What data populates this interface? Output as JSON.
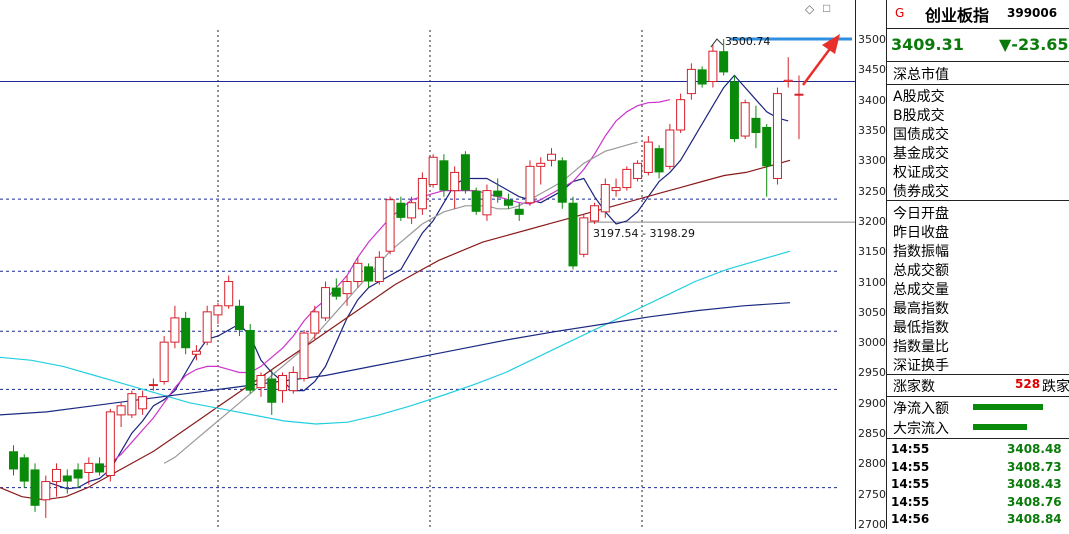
{
  "window": {
    "diamond_icon": "◇",
    "close_icon": "□"
  },
  "header": {
    "flag": "G",
    "name": "创业板指",
    "code": "399006"
  },
  "quote": {
    "price": "3409.31",
    "change": "▼-23.65"
  },
  "labels": {
    "market_value": "深总市值",
    "group1": [
      "A股成交",
      "B股成交",
      "国债成交",
      "基金成交",
      "权证成交",
      "债券成交"
    ],
    "group2": [
      "今日开盘",
      "昨日收盘",
      "指数振幅",
      "总成交额",
      "总成交量",
      "最高指数",
      "最低指数",
      "指数量比",
      "深证换手"
    ],
    "rise_label": "涨家数",
    "rise_value": "528",
    "fall_label": "跌家",
    "net_flow": "净流入额",
    "block_flow": "大宗流入"
  },
  "ticks": [
    {
      "time": "14:55",
      "price": "3408.48"
    },
    {
      "time": "14:55",
      "price": "3408.73"
    },
    {
      "time": "14:55",
      "price": "3408.43"
    },
    {
      "time": "14:55",
      "price": "3408.76"
    },
    {
      "time": "14:56",
      "price": "3408.84"
    }
  ],
  "colors": {
    "up": "#d6202a",
    "down": "#0a8a0a",
    "ma5": "#1a237e",
    "ma10": "#cc33cc",
    "ma20": "#999999",
    "ma60": "#8b1a1a",
    "ma120": "#22cfe0",
    "ma250": "#1a2a80",
    "arrow": "#e8302a",
    "target_line": "#2f8fe0"
  },
  "chart_data": {
    "type": "candlestick",
    "ylim": [
      2700,
      3510
    ],
    "yticks": [
      2700,
      2750,
      2800,
      2850,
      2900,
      2950,
      3000,
      3050,
      3100,
      3150,
      3200,
      3250,
      3300,
      3350,
      3400,
      3450,
      3500
    ],
    "annotations": {
      "high_label": "3500.74",
      "range_label": "3197.54 - 3198.29"
    },
    "dashed_levels": [
      3236,
      3117,
      3018,
      2922,
      2760
    ],
    "solid_levels": [
      3430,
      3198
    ],
    "target_level": 3500,
    "candles": [
      {
        "o": 2820,
        "h": 2830,
        "l": 2780,
        "c": 2790
      },
      {
        "o": 2810,
        "h": 2815,
        "l": 2760,
        "c": 2770
      },
      {
        "o": 2790,
        "h": 2800,
        "l": 2720,
        "c": 2730
      },
      {
        "o": 2740,
        "h": 2780,
        "l": 2710,
        "c": 2770
      },
      {
        "o": 2770,
        "h": 2800,
        "l": 2745,
        "c": 2790
      },
      {
        "o": 2780,
        "h": 2790,
        "l": 2750,
        "c": 2770
      },
      {
        "o": 2790,
        "h": 2800,
        "l": 2760,
        "c": 2775
      },
      {
        "o": 2785,
        "h": 2810,
        "l": 2765,
        "c": 2800
      },
      {
        "o": 2800,
        "h": 2810,
        "l": 2780,
        "c": 2785
      },
      {
        "o": 2780,
        "h": 2890,
        "l": 2770,
        "c": 2885
      },
      {
        "o": 2880,
        "h": 2900,
        "l": 2860,
        "c": 2895
      },
      {
        "o": 2880,
        "h": 2920,
        "l": 2875,
        "c": 2915
      },
      {
        "o": 2890,
        "h": 2920,
        "l": 2880,
        "c": 2910
      },
      {
        "o": 2930,
        "h": 2940,
        "l": 2920,
        "c": 2930
      },
      {
        "o": 2935,
        "h": 3010,
        "l": 2930,
        "c": 3000
      },
      {
        "o": 3000,
        "h": 3060,
        "l": 2990,
        "c": 3040
      },
      {
        "o": 3040,
        "h": 3050,
        "l": 2980,
        "c": 2990
      },
      {
        "o": 2980,
        "h": 2995,
        "l": 2970,
        "c": 2985
      },
      {
        "o": 3000,
        "h": 3060,
        "l": 2995,
        "c": 3050
      },
      {
        "o": 3045,
        "h": 3065,
        "l": 3030,
        "c": 3060
      },
      {
        "o": 3060,
        "h": 3110,
        "l": 3055,
        "c": 3100
      },
      {
        "o": 3060,
        "h": 3070,
        "l": 3010,
        "c": 3020
      },
      {
        "o": 3020,
        "h": 3030,
        "l": 2915,
        "c": 2920
      },
      {
        "o": 2925,
        "h": 2950,
        "l": 2910,
        "c": 2945
      },
      {
        "o": 2940,
        "h": 2955,
        "l": 2880,
        "c": 2900
      },
      {
        "o": 2920,
        "h": 2950,
        "l": 2900,
        "c": 2945
      },
      {
        "o": 2920,
        "h": 2960,
        "l": 2915,
        "c": 2950
      },
      {
        "o": 2940,
        "h": 3020,
        "l": 2935,
        "c": 3015
      },
      {
        "o": 3015,
        "h": 3060,
        "l": 3005,
        "c": 3050
      },
      {
        "o": 3040,
        "h": 3100,
        "l": 3035,
        "c": 3090
      },
      {
        "o": 3090,
        "h": 3105,
        "l": 3070,
        "c": 3075
      },
      {
        "o": 3080,
        "h": 3110,
        "l": 3060,
        "c": 3100
      },
      {
        "o": 3100,
        "h": 3140,
        "l": 3090,
        "c": 3130
      },
      {
        "o": 3125,
        "h": 3130,
        "l": 3090,
        "c": 3100
      },
      {
        "o": 3100,
        "h": 3150,
        "l": 3095,
        "c": 3140
      },
      {
        "o": 3150,
        "h": 3240,
        "l": 3145,
        "c": 3235
      },
      {
        "o": 3230,
        "h": 3240,
        "l": 3200,
        "c": 3205
      },
      {
        "o": 3205,
        "h": 3240,
        "l": 3195,
        "c": 3230
      },
      {
        "o": 3220,
        "h": 3280,
        "l": 3210,
        "c": 3270
      },
      {
        "o": 3260,
        "h": 3310,
        "l": 3255,
        "c": 3305
      },
      {
        "o": 3300,
        "h": 3310,
        "l": 3240,
        "c": 3250
      },
      {
        "o": 3250,
        "h": 3290,
        "l": 3220,
        "c": 3280
      },
      {
        "o": 3310,
        "h": 3315,
        "l": 3245,
        "c": 3250
      },
      {
        "o": 3250,
        "h": 3255,
        "l": 3210,
        "c": 3215
      },
      {
        "o": 3210,
        "h": 3260,
        "l": 3200,
        "c": 3250
      },
      {
        "o": 3250,
        "h": 3270,
        "l": 3230,
        "c": 3240
      },
      {
        "o": 3235,
        "h": 3245,
        "l": 3220,
        "c": 3225
      },
      {
        "o": 3220,
        "h": 3230,
        "l": 3200,
        "c": 3210
      },
      {
        "o": 3230,
        "h": 3300,
        "l": 3225,
        "c": 3290
      },
      {
        "o": 3290,
        "h": 3305,
        "l": 3260,
        "c": 3295
      },
      {
        "o": 3300,
        "h": 3320,
        "l": 3290,
        "c": 3310
      },
      {
        "o": 3300,
        "h": 3305,
        "l": 3220,
        "c": 3230
      },
      {
        "o": 3230,
        "h": 3240,
        "l": 3120,
        "c": 3125
      },
      {
        "o": 3145,
        "h": 3210,
        "l": 3140,
        "c": 3205
      },
      {
        "o": 3200,
        "h": 3230,
        "l": 3195,
        "c": 3225
      },
      {
        "o": 3215,
        "h": 3270,
        "l": 3205,
        "c": 3260
      },
      {
        "o": 3250,
        "h": 3270,
        "l": 3240,
        "c": 3255
      },
      {
        "o": 3255,
        "h": 3290,
        "l": 3250,
        "c": 3285
      },
      {
        "o": 3270,
        "h": 3300,
        "l": 3265,
        "c": 3295
      },
      {
        "o": 3280,
        "h": 3340,
        "l": 3275,
        "c": 3330
      },
      {
        "o": 3320,
        "h": 3325,
        "l": 3270,
        "c": 3280
      },
      {
        "o": 3290,
        "h": 3360,
        "l": 3285,
        "c": 3350
      },
      {
        "o": 3350,
        "h": 3410,
        "l": 3345,
        "c": 3400
      },
      {
        "o": 3410,
        "h": 3460,
        "l": 3400,
        "c": 3450
      },
      {
        "o": 3450,
        "h": 3455,
        "l": 3420,
        "c": 3425
      },
      {
        "o": 3430,
        "h": 3490,
        "l": 3420,
        "c": 3480
      },
      {
        "o": 3480,
        "h": 3500,
        "l": 3440,
        "c": 3445
      },
      {
        "o": 3430,
        "h": 3440,
        "l": 3330,
        "c": 3335
      },
      {
        "o": 3340,
        "h": 3400,
        "l": 3335,
        "c": 3395
      },
      {
        "o": 3370,
        "h": 3390,
        "l": 3320,
        "c": 3345
      },
      {
        "o": 3355,
        "h": 3360,
        "l": 3240,
        "c": 3290
      },
      {
        "o": 3270,
        "h": 3420,
        "l": 3260,
        "c": 3410
      },
      {
        "o": 3430,
        "h": 3470,
        "l": 3420,
        "c": 3432
      },
      {
        "o": 3408,
        "h": 3440,
        "l": 3335,
        "c": 3409
      }
    ],
    "ma_series": [
      {
        "key": "ma5",
        "offset": 3,
        "values": [
          2770,
          2764,
          2758,
          2760,
          2770,
          2775,
          2790,
          2820,
          2850,
          2870,
          2895,
          2905,
          2920,
          2950,
          2980,
          3005,
          3010,
          3020,
          3030,
          3010,
          2970,
          2950,
          2935,
          2920,
          2920,
          2935,
          2960,
          3000,
          3040,
          3070,
          3090,
          3100,
          3110,
          3120,
          3150,
          3180,
          3200,
          3230,
          3260,
          3270,
          3270,
          3270,
          3260,
          3250,
          3240,
          3235,
          3230,
          3240,
          3250,
          3265,
          3270,
          3240,
          3215,
          3195,
          3200,
          3215,
          3240,
          3265,
          3280,
          3300,
          3330,
          3360,
          3390,
          3420,
          3440,
          3420,
          3400,
          3380,
          3370,
          3365
        ]
      },
      {
        "key": "ma10",
        "offset": 8,
        "values": [
          2790,
          2800,
          2815,
          2835,
          2855,
          2875,
          2900,
          2925,
          2945,
          2955,
          2960,
          2960,
          2955,
          2950,
          2950,
          2960,
          2975,
          2990,
          3010,
          3035,
          3055,
          3070,
          3090,
          3110,
          3140,
          3165,
          3185,
          3205,
          3220,
          3235,
          3240,
          3245,
          3250,
          3250,
          3250,
          3250,
          3245,
          3240,
          3235,
          3230,
          3228,
          3235,
          3245,
          3255,
          3265,
          3285,
          3310,
          3340,
          3365,
          3380,
          3390,
          3395,
          3396,
          3400
        ]
      },
      {
        "key": "ma20",
        "offset": 14,
        "values": [
          2800,
          2810,
          2825,
          2840,
          2855,
          2870,
          2885,
          2900,
          2915,
          2930,
          2945,
          2960,
          2975,
          2990,
          3010,
          3030,
          3050,
          3070,
          3090,
          3110,
          3130,
          3150,
          3165,
          3180,
          3195,
          3205,
          3215,
          3220,
          3225,
          3225,
          3225,
          3220,
          3220,
          3225,
          3235,
          3245,
          3255,
          3265,
          3280,
          3295,
          3305,
          3315,
          3320,
          3325,
          3330
        ]
      },
      {
        "key": "ma60",
        "offset": 0,
        "values": [
          2760,
          2745,
          2740,
          2745,
          2760,
          2780,
          2800,
          2820,
          2845,
          2870,
          2895,
          2920,
          2945,
          2970,
          2995,
          3020,
          3045,
          3070,
          3095,
          3115,
          3135,
          3150,
          3165,
          3175,
          3185,
          3195,
          3205,
          3215,
          3225,
          3235,
          3245,
          3255,
          3265,
          3275,
          3280,
          3290,
          3300
        ]
      },
      {
        "key": "ma120",
        "offset": 0,
        "values": [
          2975,
          2970,
          2960,
          2945,
          2930,
          2915,
          2900,
          2890,
          2880,
          2870,
          2865,
          2868,
          2880,
          2895,
          2912,
          2930,
          2950,
          2975,
          3000,
          3025,
          3050,
          3075,
          3100,
          3120,
          3135,
          3150
        ]
      },
      {
        "key": "ma250",
        "offset": 0,
        "values": [
          2880,
          2885,
          2895,
          2905,
          2915,
          2925,
          2935,
          2945,
          2960,
          2975,
          2990,
          3005,
          3018,
          3030,
          3042,
          3052,
          3060,
          3065
        ]
      }
    ]
  }
}
